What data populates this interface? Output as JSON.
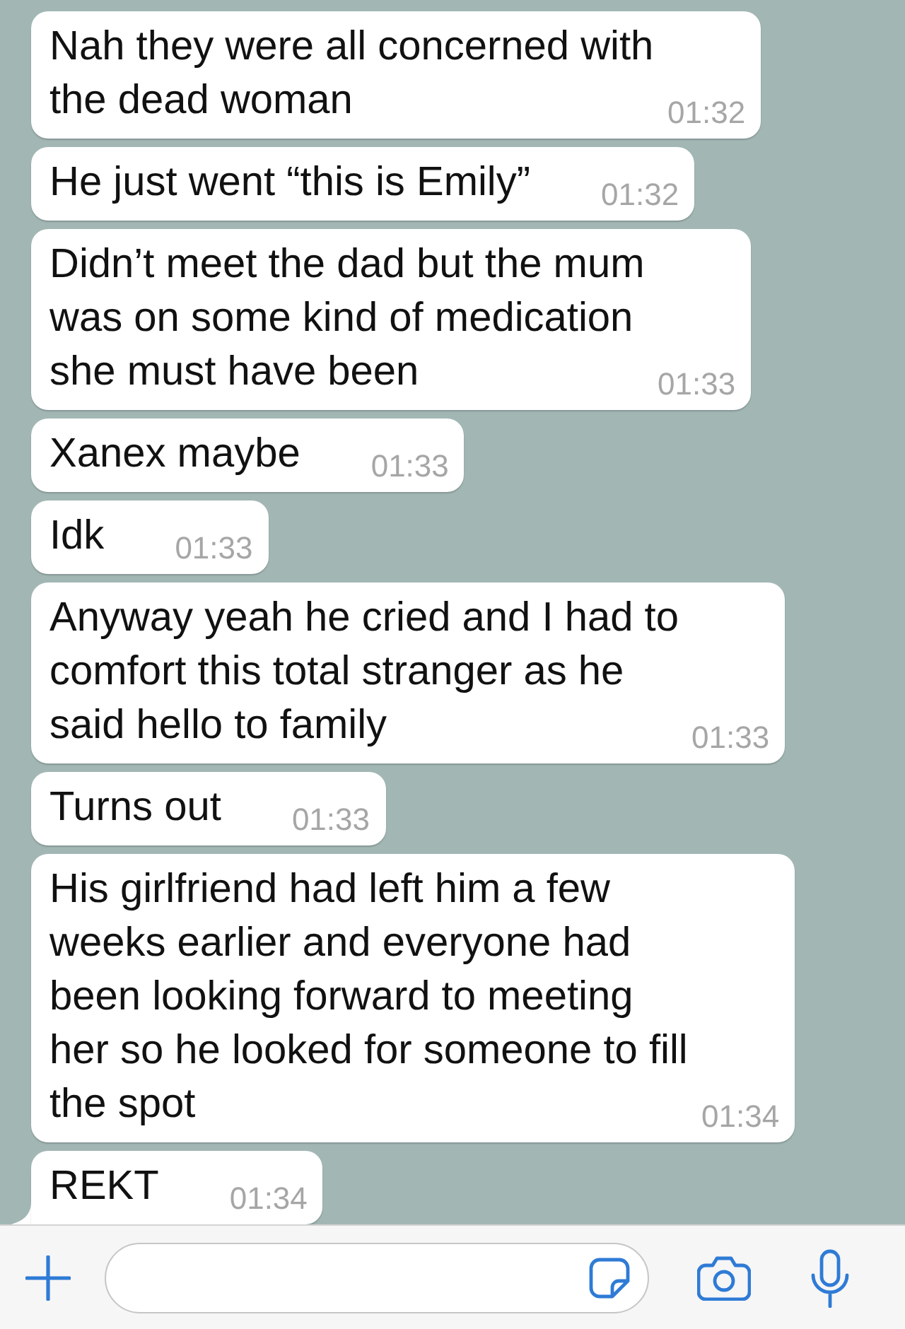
{
  "messages": [
    {
      "text": "Nah they were all concerned with the dead woman",
      "time": "01:32",
      "tail": false
    },
    {
      "text": "He just went “this is Emily”",
      "time": "01:32",
      "tail": false
    },
    {
      "text": "Didn’t meet the dad but the mum was on some kind of medication she must have been",
      "time": "01:33",
      "tail": false
    },
    {
      "text": "Xanex maybe",
      "time": "01:33",
      "tail": false
    },
    {
      "text": "Idk",
      "time": "01:33",
      "tail": false
    },
    {
      "text": "Anyway yeah he cried and I had to comfort this total stranger as he said hello to family",
      "time": "01:33",
      "tail": false
    },
    {
      "text": "Turns out",
      "time": "01:33",
      "tail": false
    },
    {
      "text": "His girlfriend had left him a few weeks earlier and everyone had been looking forward to meeting her so he looked for someone to fill the spot",
      "time": "01:34",
      "tail": false
    },
    {
      "text": "REKT",
      "time": "01:34",
      "tail": true
    }
  ]
}
